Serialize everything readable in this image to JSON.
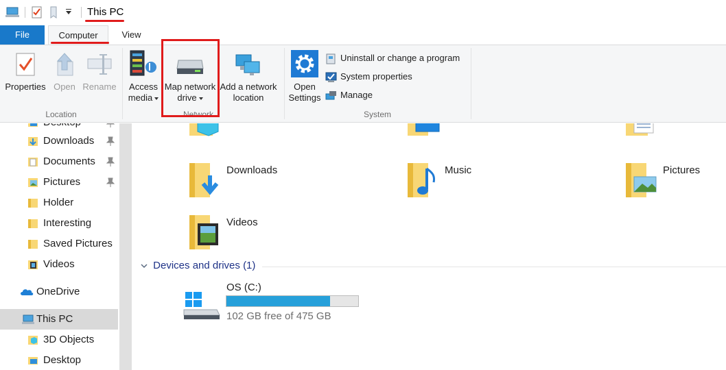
{
  "window": {
    "title": "This PC"
  },
  "tabs": [
    {
      "label": "File"
    },
    {
      "label": "Computer"
    },
    {
      "label": "View"
    }
  ],
  "ribbon": {
    "location_group": {
      "label": "Location",
      "buttons": [
        {
          "label": "Properties",
          "icon": "properties-checklist-icon",
          "enabled": true
        },
        {
          "label": "Open",
          "icon": "open-arrow-icon",
          "enabled": false
        },
        {
          "label": "Rename",
          "icon": "rename-icon",
          "enabled": false
        }
      ]
    },
    "network_group": {
      "label": "Network",
      "buttons": [
        {
          "label_line1": "Access",
          "label_line2": "media",
          "icon": "media-server-icon",
          "dropdown": true
        },
        {
          "label_line1": "Map network",
          "label_line2": "drive",
          "icon": "network-drive-icon",
          "dropdown": true
        },
        {
          "label_line1": "Add a network",
          "label_line2": "location",
          "icon": "network-location-icon",
          "dropdown": false
        }
      ]
    },
    "system_group": {
      "label": "System",
      "open_settings": {
        "label_line1": "Open",
        "label_line2": "Settings",
        "icon": "settings-gear-icon"
      },
      "small_buttons": [
        {
          "label": "Uninstall or change a program",
          "icon": "uninstall-icon"
        },
        {
          "label": "System properties",
          "icon": "system-properties-icon"
        },
        {
          "label": "Manage",
          "icon": "manage-computer-icon"
        }
      ]
    }
  },
  "nav_pane": {
    "items": [
      {
        "label": "Desktop",
        "icon": "folder-desktop-icon",
        "pinned": true
      },
      {
        "label": "Downloads",
        "icon": "folder-downloads-icon",
        "pinned": true
      },
      {
        "label": "Documents",
        "icon": "folder-documents-icon",
        "pinned": true
      },
      {
        "label": "Pictures",
        "icon": "folder-pictures-icon",
        "pinned": true
      },
      {
        "label": "Holder",
        "icon": "folder-icon",
        "pinned": false
      },
      {
        "label": "Interesting",
        "icon": "folder-icon",
        "pinned": false
      },
      {
        "label": "Saved Pictures",
        "icon": "folder-icon",
        "pinned": false
      },
      {
        "label": "Videos",
        "icon": "folder-videos-icon",
        "pinned": false
      },
      {
        "label": "OneDrive",
        "icon": "onedrive-cloud-icon",
        "pinned": false
      },
      {
        "label": "This PC",
        "icon": "this-pc-icon",
        "pinned": false,
        "selected": true
      },
      {
        "label": "3D Objects",
        "icon": "folder-3d-objects-icon",
        "pinned": false
      },
      {
        "label": "Desktop",
        "icon": "folder-desktop-icon",
        "pinned": false
      }
    ]
  },
  "content": {
    "folders": [
      {
        "label": "Downloads",
        "icon": "folder-downloads-icon"
      },
      {
        "label": "Music",
        "icon": "folder-music-icon"
      },
      {
        "label": "Pictures",
        "icon": "folder-pictures-icon"
      },
      {
        "label": "Videos",
        "icon": "folder-videos-icon"
      }
    ],
    "devices_section": {
      "header": "Devices and drives (1)"
    },
    "drive": {
      "label": "OS (C:)",
      "free_text": "102 GB free of 475 GB",
      "used_fraction": 0.785,
      "icon": "windows-drive-icon"
    }
  },
  "colors": {
    "accent": "#1979ca",
    "highlight": "#e01b1b",
    "drive_bar": "#26a0da",
    "folder": "#f8d775"
  }
}
